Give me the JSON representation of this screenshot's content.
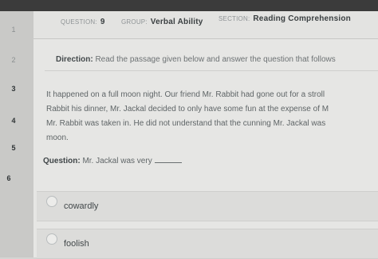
{
  "header": {
    "question_label": "QUESTION:",
    "question_number": "9",
    "group_label": "GROUP:",
    "group_value": "Verbal Ability",
    "section_label": "SECTION:",
    "section_value": "Reading Comprehension"
  },
  "sidebar": {
    "numbers": [
      "1",
      "2",
      "3",
      "4",
      "5",
      "6"
    ]
  },
  "direction": {
    "label": "Direction:",
    "text": "Read the passage given below and answer the question that follows"
  },
  "passage": {
    "lines": [
      "It happened on a full moon night. Our friend Mr. Rabbit had gone out for a stroll",
      "Rabbit his dinner, Mr. Jackal decided to only have some fun at the expense of M",
      "Mr. Rabbit was taken in. He did not understand that the cunning Mr. Jackal was",
      "moon."
    ]
  },
  "question": {
    "label": "Question:",
    "text": "Mr. Jackal was very"
  },
  "options": [
    {
      "label": "cowardly"
    },
    {
      "label": "foolish"
    }
  ]
}
